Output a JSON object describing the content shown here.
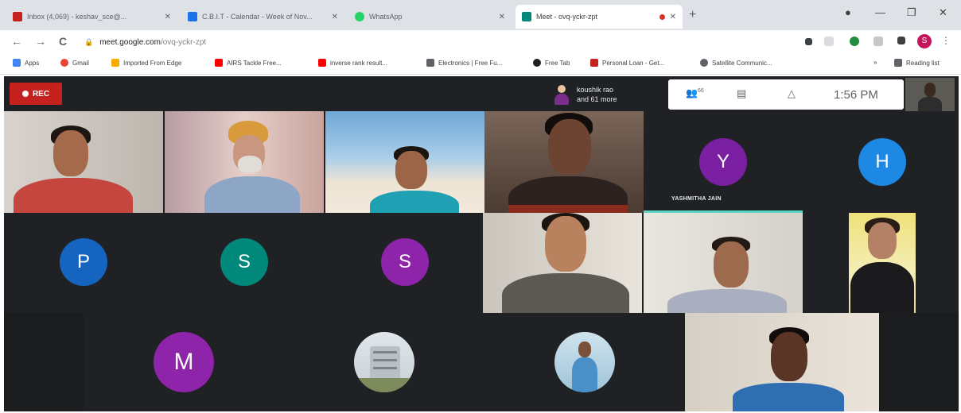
{
  "browser": {
    "tabs": [
      {
        "title": "Inbox (4,069) - keshav_sce@...",
        "favicon_color": "#c5221f",
        "active": false
      },
      {
        "title": "C.B.I.T - Calendar - Week of Nov...",
        "favicon_color": "#1a73e8",
        "active": false
      },
      {
        "title": "WhatsApp",
        "favicon_color": "#25d366",
        "active": false
      },
      {
        "title": "Meet - ovq-yckr-zpt",
        "favicon_color": "#00897b",
        "active": true
      }
    ],
    "new_tab": "+",
    "window_controls": {
      "minimize": "—",
      "restore": "❐",
      "close": "✕"
    },
    "nav": {
      "back": "←",
      "forward": "→",
      "reload": "C"
    },
    "url": {
      "host": "meet.google.com",
      "path": "/ovq-yckr-zpt"
    },
    "profile_initial": "S",
    "bookmarks": [
      {
        "label": "Apps",
        "color": "#4285f4"
      },
      {
        "label": "Gmail",
        "color": "#ea4335"
      },
      {
        "label": "Imported From Edge",
        "color": "#f9ab00"
      },
      {
        "label": "AIRS Tackle Free...",
        "color": "#ff0000"
      },
      {
        "label": "inverse rank result...",
        "color": "#ff0000"
      },
      {
        "label": "Electronics | Free Fu...",
        "color": "#5f6368"
      },
      {
        "label": "Free Tab",
        "color": "#202124"
      },
      {
        "label": "Personal Loan - Get...",
        "color": "#c5221f"
      },
      {
        "label": "Satellite Communic...",
        "color": "#5f6368"
      },
      {
        "label": "Reading list",
        "color": "#5f6368"
      }
    ]
  },
  "meet": {
    "rec_label": "REC",
    "presenter": {
      "line1": "koushik rao",
      "line2": "and 61 more"
    },
    "controls": {
      "people_count": "66",
      "time": "1:56 PM"
    },
    "tiles": [
      {
        "type": "avatar",
        "initial": "Y",
        "color": "#7b1fa2",
        "name": "YASHMITHA JAIN",
        "speaking": true
      },
      {
        "type": "avatar",
        "initial": "H",
        "color": "#1e88e5"
      },
      {
        "type": "avatar",
        "initial": "P",
        "color": "#1565c0"
      },
      {
        "type": "avatar",
        "initial": "S",
        "color": "#00897b"
      },
      {
        "type": "avatar",
        "initial": "S",
        "color": "#8e24aa"
      },
      {
        "type": "avatar",
        "initial": "M",
        "color": "#8e24aa"
      }
    ]
  }
}
